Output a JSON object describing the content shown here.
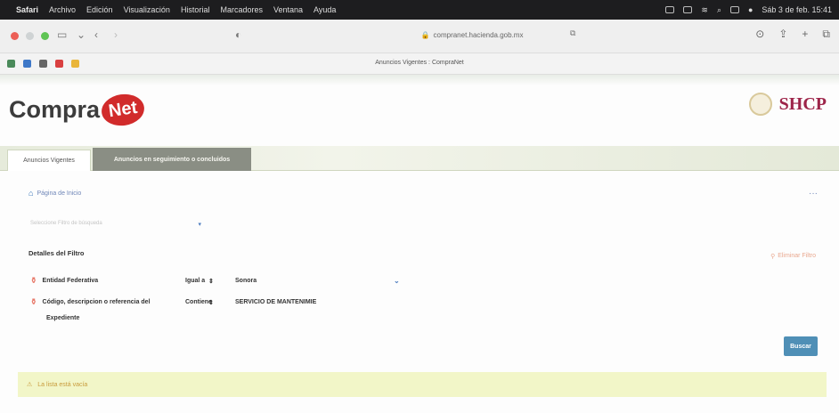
{
  "menubar": {
    "apple": "",
    "app": "Safari",
    "items": [
      "Archivo",
      "Edición",
      "Visualización",
      "Historial",
      "Marcadores",
      "Ventana",
      "Ayuda"
    ],
    "clock": "Sáb 3 de feb. 15:41"
  },
  "browser": {
    "url": "compranet.hacienda.gob.mx",
    "tab_title": "Anuncios Vigentes : CompraNet"
  },
  "header": {
    "logo_text": "Compra",
    "logo_net": "Net",
    "shcp": "SHCP"
  },
  "tabs": [
    {
      "label": "Anuncios Vigentes"
    },
    {
      "label": "Anuncios en seguimiento o concluidos"
    }
  ],
  "breadcrumb": {
    "home_label": "Página de Inicio"
  },
  "filter_select": {
    "placeholder": "Seleccione Filtro de búsqueda"
  },
  "details": {
    "title": "Detalles del Filtro",
    "clear_label": "Eliminar Filtro",
    "rows": [
      {
        "label": "Entidad Federativa",
        "operator": "Igual a",
        "value": "Sonora"
      },
      {
        "label": "Código, descripcion o referencia del",
        "operator": "Contiene",
        "value": "SERVICIO DE MANTENIMIE"
      }
    ],
    "label_cont": "Expediente"
  },
  "buscar_label": "Buscar",
  "alert": {
    "text": "La lista está vacía"
  },
  "colors": {
    "accent": "#4f8fb6",
    "brand_red": "#d12b2b",
    "shcp": "#9d2449",
    "alert_bg": "#f2f6c8"
  }
}
